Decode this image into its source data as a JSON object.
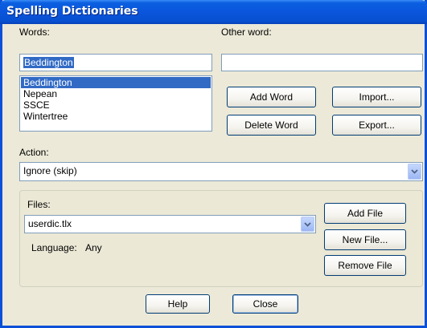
{
  "window": {
    "title": "Spelling Dictionaries"
  },
  "words": {
    "label": "Words:",
    "input_value": "Beddington",
    "list": [
      "Beddington",
      "Nepean",
      "SSCE",
      "Wintertree"
    ],
    "selected_index": 0
  },
  "other_word": {
    "label": "Other word:",
    "value": ""
  },
  "buttons": {
    "add_word": "Add Word",
    "delete_word": "Delete Word",
    "import": "Import...",
    "export": "Export...",
    "add_file": "Add File",
    "new_file": "New File...",
    "remove_file": "Remove File",
    "help": "Help",
    "close": "Close"
  },
  "action": {
    "label": "Action:",
    "value": "Ignore (skip)"
  },
  "files": {
    "label": "Files:",
    "value": "userdic.tlx",
    "language_label": "Language:",
    "language_value": "Any"
  },
  "colors": {
    "titlebar": "#0a55dc",
    "selection": "#316ac5",
    "dialog_bg": "#ece9d8"
  }
}
